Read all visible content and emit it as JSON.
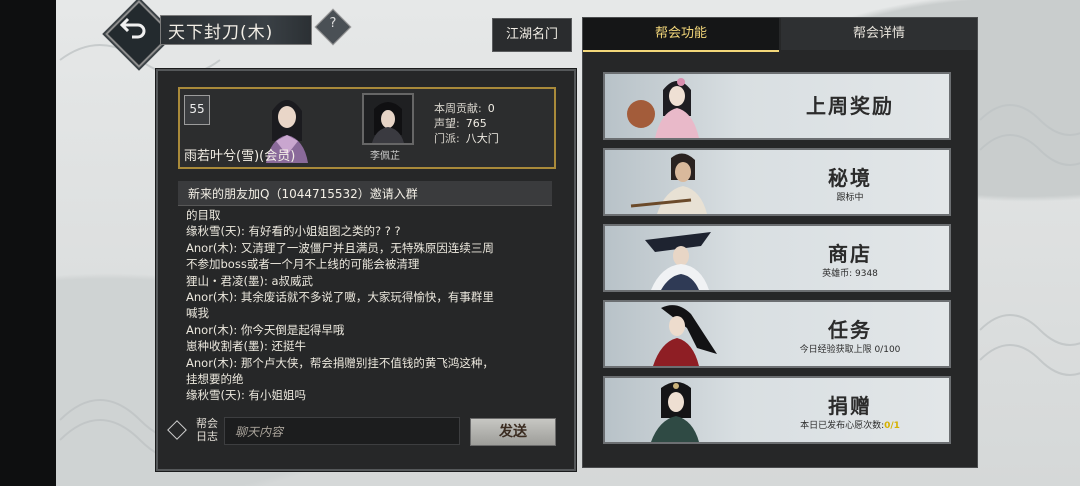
{
  "header": {
    "title": "天下封刀(木)",
    "help_label": "?"
  },
  "member": {
    "level": "55",
    "name": "雨若叶兮(雪)(会员)",
    "partner_name": "李佩芷",
    "stats": [
      {
        "label": "本周贡献:",
        "value": "0"
      },
      {
        "label": "声望:",
        "value": "765"
      },
      {
        "label": "门派:",
        "value": "八大门"
      }
    ]
  },
  "announcement": "新来的朋友加Q（1044715532）邀请入群",
  "chat_lines": [
    "的目取",
    "缘秋雪(天): 有好看的小姐姐图之类的? ? ?",
    "Anor(木): 又清理了一波僵尸并且满员，无特殊原因连续三周",
    "不参加boss或者一个月不上线的可能会被清理",
    "狸山・君凌(墨): a叔威武",
    "Anor(木): 其余废话就不多说了嗷，大家玩得愉快，有事群里",
    "喊我",
    "Anor(木): 你今天倒是起得早哦",
    "崽种收割者(墨): 还挺牛",
    "Anor(木): 那个卢大侠，帮会捐赠别挂不值钱的黄飞鸿这种，",
    "挂想要的绝",
    "缘秋雪(天): 有小姐姐吗"
  ],
  "chat_input": {
    "log_label": "帮会\n日志",
    "placeholder": "聊天内容",
    "send_label": "发送"
  },
  "tabs": {
    "jianghu": "江湖名门",
    "function": "帮会功能",
    "details": "帮会详情"
  },
  "cards": [
    {
      "title": "上周奖励",
      "sub": ""
    },
    {
      "title": "秘境",
      "sub": "跟标中"
    },
    {
      "title": "商店",
      "sub": "英雄币: 9348"
    },
    {
      "title": "任务",
      "sub": "今日经验获取上限 0/100"
    },
    {
      "title": "捐赠",
      "sub": "本日已发布心愿次数:",
      "sub_highlight": "0/1"
    }
  ],
  "colors": {
    "accent_gold": "#f3d77a",
    "card_border_gold": "#a98a3a",
    "panel_bg": "#262728"
  }
}
